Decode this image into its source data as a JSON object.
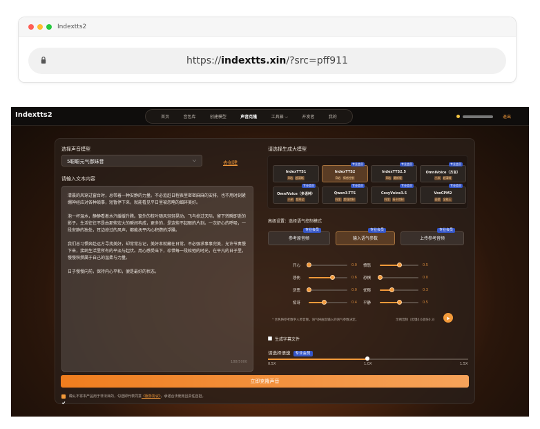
{
  "browser": {
    "tab_title": "Indextts2",
    "url_prefix": "https://",
    "url_domain": "indextts.xin",
    "url_path": "/?src=pff911"
  },
  "nav": {
    "brand": "Indextts2",
    "items": [
      {
        "label": "首页",
        "active": false
      },
      {
        "label": "音色库",
        "active": false
      },
      {
        "label": "创建模型",
        "active": false
      },
      {
        "label": "声音克隆",
        "active": true
      },
      {
        "label": "工具箱 ⌵",
        "active": false
      },
      {
        "label": "开发者",
        "active": false
      },
      {
        "label": "我的",
        "active": false
      }
    ],
    "logout": "退出"
  },
  "voice": {
    "label": "选择声音模型",
    "selected": "5聪聪元气御妹音",
    "create_link": "去创建"
  },
  "text_input": {
    "label": "请输入文本内容",
    "paragraphs": [
      "清晨的风穿过窗台时，总带着一种安静的力量。不必追赶日程表里密密麻麻的安排，也不用时刻紧绷神经应对各种琐事，短暂停下来，就能看见平日里被忽略的细碎美好。",
      "泡一杯温水，静静看着水汽缓缓升腾。窗外的枝叶随风轻轻晃动，飞鸟掠过天际，留下转瞬即逝的影子。生活往往不是由那些宏大的瞬间构成，更多的，是这些不起眼的片刻。一次舒心的呼吸，一段安静的独处，耳边掠过的风声，都能抚平内心积攒的浮躁。",
      "我们总习惯奔赴远方寻找美好，却常常忘记，美好本就藏在日常。不必强求事事完美，允许节奏慢下来，接纳生活里所有的平淡与起伏。用心感受当下，珍惜每一段松弛的时光，在平凡的日子里，慢慢积攒属于自己的温柔与力量。",
      "日子慢慢向前，保持内心平和，便是最好的状态。"
    ],
    "count": "188/5000"
  },
  "models": {
    "label": "请选择生成大模型",
    "vip": "专业会员",
    "items": [
      {
        "name": "IndexTTS1",
        "tags": [
          "B站",
          "超清晰"
        ],
        "vip": false,
        "selected": false
      },
      {
        "name": "IndexTTS2",
        "tags": [
          "B站",
          "情感控制"
        ],
        "vip": true,
        "selected": true
      },
      {
        "name": "IndexTTS2.5",
        "tags": [
          "B站",
          "最新版"
        ],
        "vip": true,
        "selected": false
      },
      {
        "name": "OmniVoice（方言）",
        "tags": [
          "小米",
          "超清晰"
        ],
        "vip": true,
        "selected": false
      },
      {
        "name": "OmniVoice（多语种）",
        "tags": [
          "小米",
          "超两全"
        ],
        "vip": true,
        "selected": false
      },
      {
        "name": "Qwen3-TTS",
        "tags": [
          "阿里",
          "超强控制"
        ],
        "vip": true,
        "selected": false
      },
      {
        "name": "CosyVoice3.5",
        "tags": [
          "阿里",
          "接卡控制"
        ],
        "vip": true,
        "selected": false
      },
      {
        "name": "VoxCPM2",
        "tags": [
          "面壁",
          "全能王"
        ],
        "vip": true,
        "selected": false
      }
    ]
  },
  "emotion": {
    "label": "高级设置：选择语气控制模式",
    "modes": [
      {
        "label": "参考原音频",
        "vip": "专业会员",
        "selected": false
      },
      {
        "label": "输入语气参数",
        "vip": "专业会员",
        "selected": true
      },
      {
        "label": "上传参考音频",
        "vip": "专业会员",
        "selected": false
      }
    ],
    "sliders": [
      {
        "label": "开心",
        "value": "0.0",
        "level": 0.0
      },
      {
        "label": "愤怒",
        "value": "0.5",
        "level": 0.5
      },
      {
        "label": "悲伤",
        "value": "0.6",
        "level": 0.6
      },
      {
        "label": "恐惧",
        "value": "0.0",
        "level": 0.0
      },
      {
        "label": "厌恶",
        "value": "0.0",
        "level": 0.0
      },
      {
        "label": "忧郁",
        "value": "0.3",
        "level": 0.3
      },
      {
        "label": "惊讶",
        "value": "0.4",
        "level": 0.4
      },
      {
        "label": "平静",
        "value": "0.5",
        "level": 0.5
      }
    ],
    "note": "* 合色将参考数字人原音频，语气将由您输入的语气参数决定。",
    "sample": "示例音频（恐惧0.6悲伤0.3）"
  },
  "subtitle_label": "生成字幕文件",
  "speed": {
    "label": "请选择语速",
    "vip": "专业会员",
    "level": 0.5,
    "marks": [
      "0.5X",
      "1.0X",
      "1.5X"
    ]
  },
  "generate_button": "立即克隆声音",
  "agreement": {
    "prefix": "确认不将本产品用于非法目的，勾选即代表同意",
    "link": "《服务协议》",
    "suffix": "，承诺合法使用且责任自担。"
  },
  "colors": {
    "accent": "#f39a3a",
    "vip": "#3556c8"
  }
}
